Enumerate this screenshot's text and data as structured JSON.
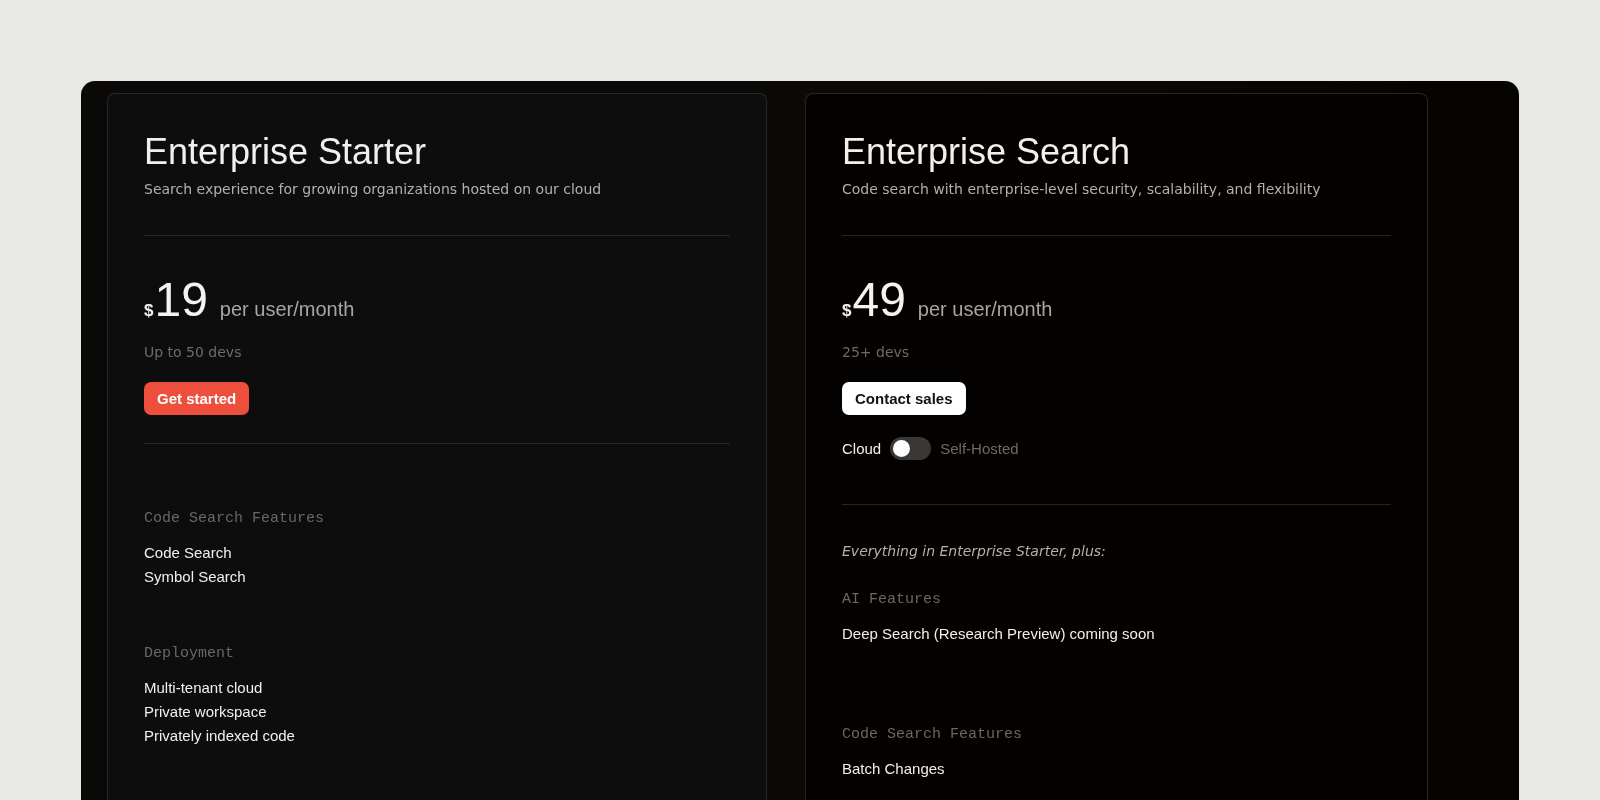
{
  "plans": [
    {
      "title": "Enterprise Starter",
      "subtitle": "Search experience for growing organizations hosted on our cloud",
      "currency": "$",
      "price": "19",
      "period": "per user/month",
      "seats": "Up to 50 devs",
      "button": {
        "label": "Get started",
        "kind": "primary"
      },
      "sections": [
        {
          "label": "Code Search Features",
          "items": [
            "Code Search",
            "Symbol Search"
          ]
        },
        {
          "label": "Deployment",
          "items": [
            "Multi-tenant cloud",
            "Private workspace",
            "Privately indexed code"
          ]
        }
      ]
    },
    {
      "title": "Enterprise Search",
      "subtitle": "Code search with enterprise-level security, scalability, and flexibility",
      "currency": "$",
      "price": "49",
      "period": "per user/month",
      "seats": "25+ devs",
      "button": {
        "label": "Contact sales",
        "kind": "secondary"
      },
      "hosting": [
        {
          "label": "Cloud",
          "selected": true
        },
        {
          "label": "Self-Hosted",
          "selected": false
        }
      ],
      "intro": "Everything in Enterprise Starter, plus:",
      "sections": [
        {
          "label": "AI Features",
          "items": [
            "Deep Search (Research Preview) coming soon"
          ]
        },
        {
          "label": "Code Search Features",
          "items": [
            "Batch Changes"
          ]
        }
      ]
    }
  ]
}
